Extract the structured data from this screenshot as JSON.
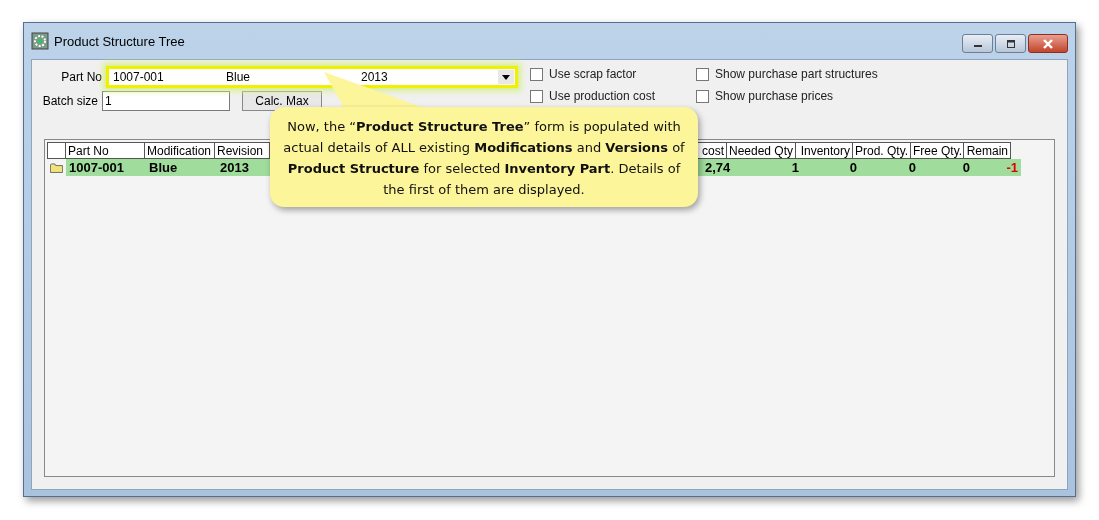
{
  "window": {
    "title": "Product Structure Tree"
  },
  "part_no": {
    "label": "Part No",
    "values": [
      "1007-001",
      "Blue",
      "2013"
    ],
    "highlighted": true
  },
  "batch_size": {
    "label": "Batch size",
    "value": "1"
  },
  "calc_button": "Calc. Max",
  "options": [
    {
      "label": "Use scrap factor",
      "checked": false
    },
    {
      "label": "Use production cost",
      "checked": false
    },
    {
      "label": "Show purchase part structures",
      "checked": false
    },
    {
      "label": "Show purchase prices",
      "checked": false
    }
  ],
  "table": {
    "columns": [
      "Part No",
      "Modification",
      "Revision",
      "cost",
      "Needed Qty",
      "Inventory",
      "Prod. Qty.",
      "Free Qty.",
      "Remain"
    ],
    "rows": [
      {
        "selected": true,
        "cells": [
          {
            "text": "1007-001",
            "negative": false
          },
          {
            "text": "Blue",
            "negative": false
          },
          {
            "text": "2013",
            "negative": false
          },
          {
            "text": "2,74",
            "negative": false
          },
          {
            "text": "1",
            "negative": false
          },
          {
            "text": "0",
            "negative": false
          },
          {
            "text": "0",
            "negative": false
          },
          {
            "text": "0",
            "negative": false
          },
          {
            "text": "-1",
            "negative": true
          }
        ]
      }
    ]
  },
  "callout": "Now, the “**Product Structure Tree**” form is populated with actual details of ALL existing **Modifications** and **Versions** of **Product Structure** for selected **Inventory Part**.  Details of the first of them are displayed."
}
